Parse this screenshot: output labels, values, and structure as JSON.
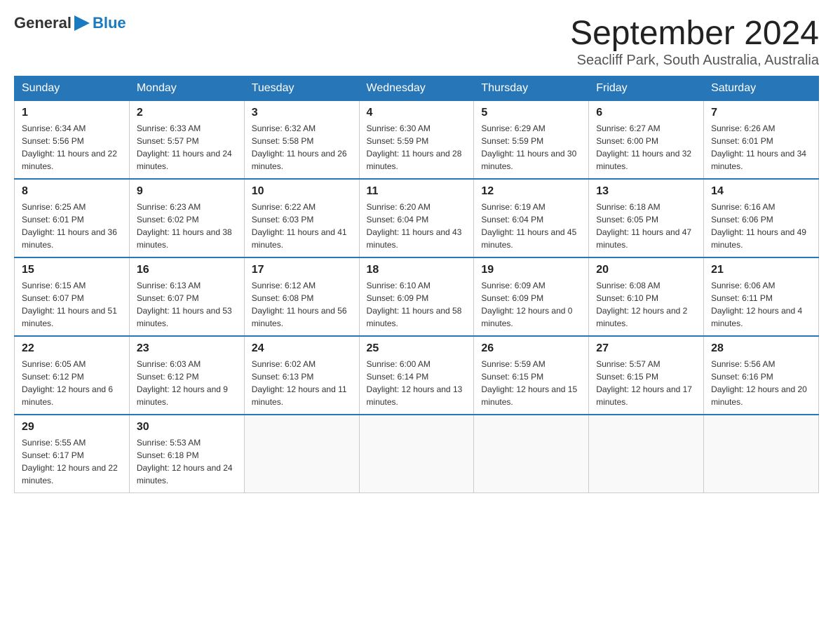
{
  "header": {
    "logo_general": "General",
    "logo_blue": "Blue",
    "month_title": "September 2024",
    "location": "Seacliff Park, South Australia, Australia"
  },
  "weekdays": [
    "Sunday",
    "Monday",
    "Tuesday",
    "Wednesday",
    "Thursday",
    "Friday",
    "Saturday"
  ],
  "weeks": [
    [
      {
        "day": "1",
        "sunrise": "Sunrise: 6:34 AM",
        "sunset": "Sunset: 5:56 PM",
        "daylight": "Daylight: 11 hours and 22 minutes."
      },
      {
        "day": "2",
        "sunrise": "Sunrise: 6:33 AM",
        "sunset": "Sunset: 5:57 PM",
        "daylight": "Daylight: 11 hours and 24 minutes."
      },
      {
        "day": "3",
        "sunrise": "Sunrise: 6:32 AM",
        "sunset": "Sunset: 5:58 PM",
        "daylight": "Daylight: 11 hours and 26 minutes."
      },
      {
        "day": "4",
        "sunrise": "Sunrise: 6:30 AM",
        "sunset": "Sunset: 5:59 PM",
        "daylight": "Daylight: 11 hours and 28 minutes."
      },
      {
        "day": "5",
        "sunrise": "Sunrise: 6:29 AM",
        "sunset": "Sunset: 5:59 PM",
        "daylight": "Daylight: 11 hours and 30 minutes."
      },
      {
        "day": "6",
        "sunrise": "Sunrise: 6:27 AM",
        "sunset": "Sunset: 6:00 PM",
        "daylight": "Daylight: 11 hours and 32 minutes."
      },
      {
        "day": "7",
        "sunrise": "Sunrise: 6:26 AM",
        "sunset": "Sunset: 6:01 PM",
        "daylight": "Daylight: 11 hours and 34 minutes."
      }
    ],
    [
      {
        "day": "8",
        "sunrise": "Sunrise: 6:25 AM",
        "sunset": "Sunset: 6:01 PM",
        "daylight": "Daylight: 11 hours and 36 minutes."
      },
      {
        "day": "9",
        "sunrise": "Sunrise: 6:23 AM",
        "sunset": "Sunset: 6:02 PM",
        "daylight": "Daylight: 11 hours and 38 minutes."
      },
      {
        "day": "10",
        "sunrise": "Sunrise: 6:22 AM",
        "sunset": "Sunset: 6:03 PM",
        "daylight": "Daylight: 11 hours and 41 minutes."
      },
      {
        "day": "11",
        "sunrise": "Sunrise: 6:20 AM",
        "sunset": "Sunset: 6:04 PM",
        "daylight": "Daylight: 11 hours and 43 minutes."
      },
      {
        "day": "12",
        "sunrise": "Sunrise: 6:19 AM",
        "sunset": "Sunset: 6:04 PM",
        "daylight": "Daylight: 11 hours and 45 minutes."
      },
      {
        "day": "13",
        "sunrise": "Sunrise: 6:18 AM",
        "sunset": "Sunset: 6:05 PM",
        "daylight": "Daylight: 11 hours and 47 minutes."
      },
      {
        "day": "14",
        "sunrise": "Sunrise: 6:16 AM",
        "sunset": "Sunset: 6:06 PM",
        "daylight": "Daylight: 11 hours and 49 minutes."
      }
    ],
    [
      {
        "day": "15",
        "sunrise": "Sunrise: 6:15 AM",
        "sunset": "Sunset: 6:07 PM",
        "daylight": "Daylight: 11 hours and 51 minutes."
      },
      {
        "day": "16",
        "sunrise": "Sunrise: 6:13 AM",
        "sunset": "Sunset: 6:07 PM",
        "daylight": "Daylight: 11 hours and 53 minutes."
      },
      {
        "day": "17",
        "sunrise": "Sunrise: 6:12 AM",
        "sunset": "Sunset: 6:08 PM",
        "daylight": "Daylight: 11 hours and 56 minutes."
      },
      {
        "day": "18",
        "sunrise": "Sunrise: 6:10 AM",
        "sunset": "Sunset: 6:09 PM",
        "daylight": "Daylight: 11 hours and 58 minutes."
      },
      {
        "day": "19",
        "sunrise": "Sunrise: 6:09 AM",
        "sunset": "Sunset: 6:09 PM",
        "daylight": "Daylight: 12 hours and 0 minutes."
      },
      {
        "day": "20",
        "sunrise": "Sunrise: 6:08 AM",
        "sunset": "Sunset: 6:10 PM",
        "daylight": "Daylight: 12 hours and 2 minutes."
      },
      {
        "day": "21",
        "sunrise": "Sunrise: 6:06 AM",
        "sunset": "Sunset: 6:11 PM",
        "daylight": "Daylight: 12 hours and 4 minutes."
      }
    ],
    [
      {
        "day": "22",
        "sunrise": "Sunrise: 6:05 AM",
        "sunset": "Sunset: 6:12 PM",
        "daylight": "Daylight: 12 hours and 6 minutes."
      },
      {
        "day": "23",
        "sunrise": "Sunrise: 6:03 AM",
        "sunset": "Sunset: 6:12 PM",
        "daylight": "Daylight: 12 hours and 9 minutes."
      },
      {
        "day": "24",
        "sunrise": "Sunrise: 6:02 AM",
        "sunset": "Sunset: 6:13 PM",
        "daylight": "Daylight: 12 hours and 11 minutes."
      },
      {
        "day": "25",
        "sunrise": "Sunrise: 6:00 AM",
        "sunset": "Sunset: 6:14 PM",
        "daylight": "Daylight: 12 hours and 13 minutes."
      },
      {
        "day": "26",
        "sunrise": "Sunrise: 5:59 AM",
        "sunset": "Sunset: 6:15 PM",
        "daylight": "Daylight: 12 hours and 15 minutes."
      },
      {
        "day": "27",
        "sunrise": "Sunrise: 5:57 AM",
        "sunset": "Sunset: 6:15 PM",
        "daylight": "Daylight: 12 hours and 17 minutes."
      },
      {
        "day": "28",
        "sunrise": "Sunrise: 5:56 AM",
        "sunset": "Sunset: 6:16 PM",
        "daylight": "Daylight: 12 hours and 20 minutes."
      }
    ],
    [
      {
        "day": "29",
        "sunrise": "Sunrise: 5:55 AM",
        "sunset": "Sunset: 6:17 PM",
        "daylight": "Daylight: 12 hours and 22 minutes."
      },
      {
        "day": "30",
        "sunrise": "Sunrise: 5:53 AM",
        "sunset": "Sunset: 6:18 PM",
        "daylight": "Daylight: 12 hours and 24 minutes."
      },
      null,
      null,
      null,
      null,
      null
    ]
  ]
}
